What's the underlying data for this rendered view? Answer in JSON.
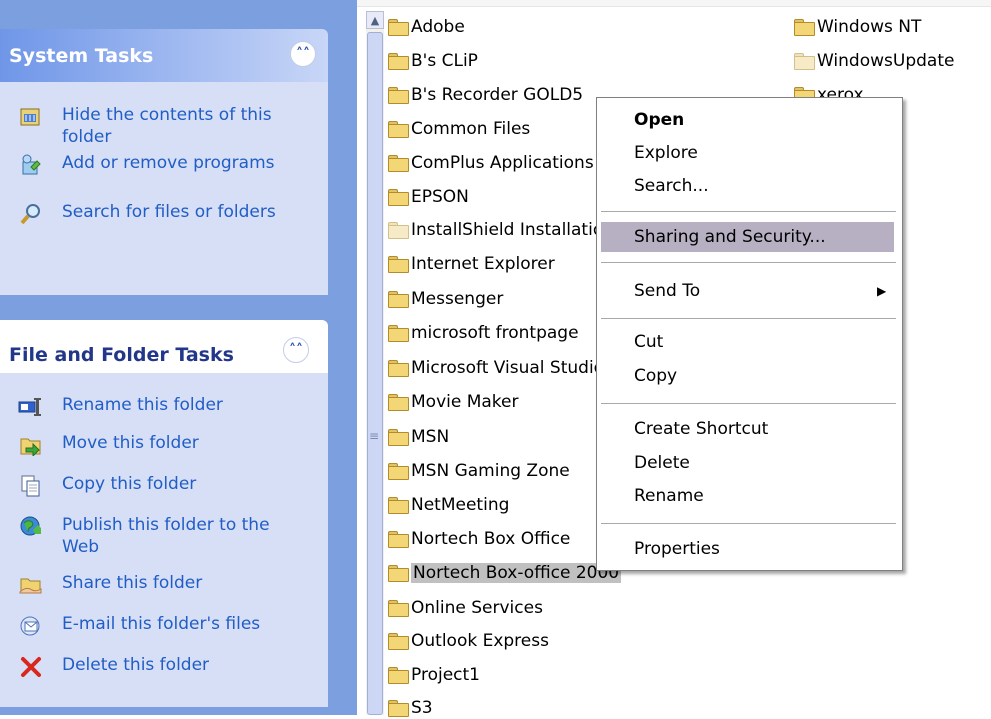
{
  "task_pane": {
    "system_tasks": {
      "title": "System Tasks",
      "items": [
        {
          "label": "Hide the contents of this folder",
          "icon": "folder-hide-icon"
        },
        {
          "label": "Add or remove programs",
          "icon": "add-remove-programs-icon"
        },
        {
          "label": "Search for files or folders",
          "icon": "search-icon"
        }
      ]
    },
    "file_folder_tasks": {
      "title": "File and Folder Tasks",
      "items": [
        {
          "label": "Rename this folder",
          "icon": "rename-icon"
        },
        {
          "label": "Move this folder",
          "icon": "move-icon"
        },
        {
          "label": "Copy this folder",
          "icon": "copy-icon"
        },
        {
          "label": "Publish this folder to the Web",
          "icon": "publish-web-icon"
        },
        {
          "label": "Share this folder",
          "icon": "share-icon"
        },
        {
          "label": "E-mail this folder's files",
          "icon": "email-icon"
        },
        {
          "label": "Delete this folder",
          "icon": "delete-icon"
        }
      ]
    }
  },
  "files": {
    "column1": [
      "Adobe",
      "B's CLiP",
      "B's Recorder GOLD5",
      "Common Files",
      "ComPlus Applications",
      "EPSON",
      "InstallShield Installation Information",
      "Internet Explorer",
      "Messenger",
      "microsoft frontpage",
      "Microsoft Visual Studio",
      "Movie Maker",
      "MSN",
      "MSN Gaming Zone",
      "NetMeeting",
      "Nortech Box Office",
      "Nortech Box-office 2000",
      "Online Services",
      "Outlook Express",
      "Project1",
      "S3"
    ],
    "column2": [
      "Windows NT",
      "WindowsUpdate",
      "xerox"
    ],
    "selected": "Nortech Box-office 2000"
  },
  "context_menu": {
    "open": "Open",
    "explore": "Explore",
    "search": "Search...",
    "sharing": "Sharing and Security...",
    "send_to": "Send To",
    "cut": "Cut",
    "copy": "Copy",
    "create_shortcut": "Create Shortcut",
    "delete": "Delete",
    "rename": "Rename",
    "properties": "Properties"
  }
}
